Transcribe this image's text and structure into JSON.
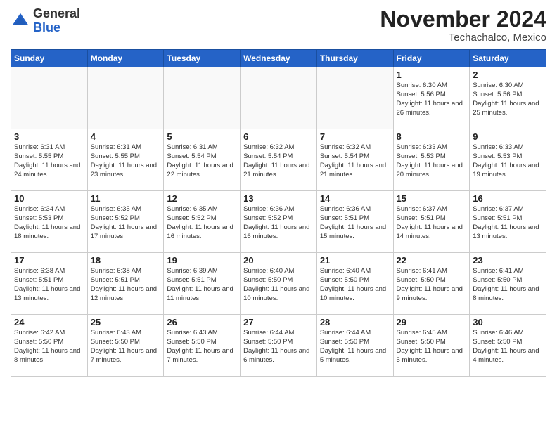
{
  "header": {
    "logo_general": "General",
    "logo_blue": "Blue",
    "month_title": "November 2024",
    "location": "Techachalco, Mexico"
  },
  "calendar": {
    "weekdays": [
      "Sunday",
      "Monday",
      "Tuesday",
      "Wednesday",
      "Thursday",
      "Friday",
      "Saturday"
    ],
    "weeks": [
      [
        {
          "day": "",
          "info": ""
        },
        {
          "day": "",
          "info": ""
        },
        {
          "day": "",
          "info": ""
        },
        {
          "day": "",
          "info": ""
        },
        {
          "day": "",
          "info": ""
        },
        {
          "day": "1",
          "info": "Sunrise: 6:30 AM\nSunset: 5:56 PM\nDaylight: 11 hours and 26 minutes."
        },
        {
          "day": "2",
          "info": "Sunrise: 6:30 AM\nSunset: 5:56 PM\nDaylight: 11 hours and 25 minutes."
        }
      ],
      [
        {
          "day": "3",
          "info": "Sunrise: 6:31 AM\nSunset: 5:55 PM\nDaylight: 11 hours and 24 minutes."
        },
        {
          "day": "4",
          "info": "Sunrise: 6:31 AM\nSunset: 5:55 PM\nDaylight: 11 hours and 23 minutes."
        },
        {
          "day": "5",
          "info": "Sunrise: 6:31 AM\nSunset: 5:54 PM\nDaylight: 11 hours and 22 minutes."
        },
        {
          "day": "6",
          "info": "Sunrise: 6:32 AM\nSunset: 5:54 PM\nDaylight: 11 hours and 21 minutes."
        },
        {
          "day": "7",
          "info": "Sunrise: 6:32 AM\nSunset: 5:54 PM\nDaylight: 11 hours and 21 minutes."
        },
        {
          "day": "8",
          "info": "Sunrise: 6:33 AM\nSunset: 5:53 PM\nDaylight: 11 hours and 20 minutes."
        },
        {
          "day": "9",
          "info": "Sunrise: 6:33 AM\nSunset: 5:53 PM\nDaylight: 11 hours and 19 minutes."
        }
      ],
      [
        {
          "day": "10",
          "info": "Sunrise: 6:34 AM\nSunset: 5:53 PM\nDaylight: 11 hours and 18 minutes."
        },
        {
          "day": "11",
          "info": "Sunrise: 6:35 AM\nSunset: 5:52 PM\nDaylight: 11 hours and 17 minutes."
        },
        {
          "day": "12",
          "info": "Sunrise: 6:35 AM\nSunset: 5:52 PM\nDaylight: 11 hours and 16 minutes."
        },
        {
          "day": "13",
          "info": "Sunrise: 6:36 AM\nSunset: 5:52 PM\nDaylight: 11 hours and 16 minutes."
        },
        {
          "day": "14",
          "info": "Sunrise: 6:36 AM\nSunset: 5:51 PM\nDaylight: 11 hours and 15 minutes."
        },
        {
          "day": "15",
          "info": "Sunrise: 6:37 AM\nSunset: 5:51 PM\nDaylight: 11 hours and 14 minutes."
        },
        {
          "day": "16",
          "info": "Sunrise: 6:37 AM\nSunset: 5:51 PM\nDaylight: 11 hours and 13 minutes."
        }
      ],
      [
        {
          "day": "17",
          "info": "Sunrise: 6:38 AM\nSunset: 5:51 PM\nDaylight: 11 hours and 13 minutes."
        },
        {
          "day": "18",
          "info": "Sunrise: 6:38 AM\nSunset: 5:51 PM\nDaylight: 11 hours and 12 minutes."
        },
        {
          "day": "19",
          "info": "Sunrise: 6:39 AM\nSunset: 5:51 PM\nDaylight: 11 hours and 11 minutes."
        },
        {
          "day": "20",
          "info": "Sunrise: 6:40 AM\nSunset: 5:50 PM\nDaylight: 11 hours and 10 minutes."
        },
        {
          "day": "21",
          "info": "Sunrise: 6:40 AM\nSunset: 5:50 PM\nDaylight: 11 hours and 10 minutes."
        },
        {
          "day": "22",
          "info": "Sunrise: 6:41 AM\nSunset: 5:50 PM\nDaylight: 11 hours and 9 minutes."
        },
        {
          "day": "23",
          "info": "Sunrise: 6:41 AM\nSunset: 5:50 PM\nDaylight: 11 hours and 8 minutes."
        }
      ],
      [
        {
          "day": "24",
          "info": "Sunrise: 6:42 AM\nSunset: 5:50 PM\nDaylight: 11 hours and 8 minutes."
        },
        {
          "day": "25",
          "info": "Sunrise: 6:43 AM\nSunset: 5:50 PM\nDaylight: 11 hours and 7 minutes."
        },
        {
          "day": "26",
          "info": "Sunrise: 6:43 AM\nSunset: 5:50 PM\nDaylight: 11 hours and 7 minutes."
        },
        {
          "day": "27",
          "info": "Sunrise: 6:44 AM\nSunset: 5:50 PM\nDaylight: 11 hours and 6 minutes."
        },
        {
          "day": "28",
          "info": "Sunrise: 6:44 AM\nSunset: 5:50 PM\nDaylight: 11 hours and 5 minutes."
        },
        {
          "day": "29",
          "info": "Sunrise: 6:45 AM\nSunset: 5:50 PM\nDaylight: 11 hours and 5 minutes."
        },
        {
          "day": "30",
          "info": "Sunrise: 6:46 AM\nSunset: 5:50 PM\nDaylight: 11 hours and 4 minutes."
        }
      ]
    ]
  }
}
